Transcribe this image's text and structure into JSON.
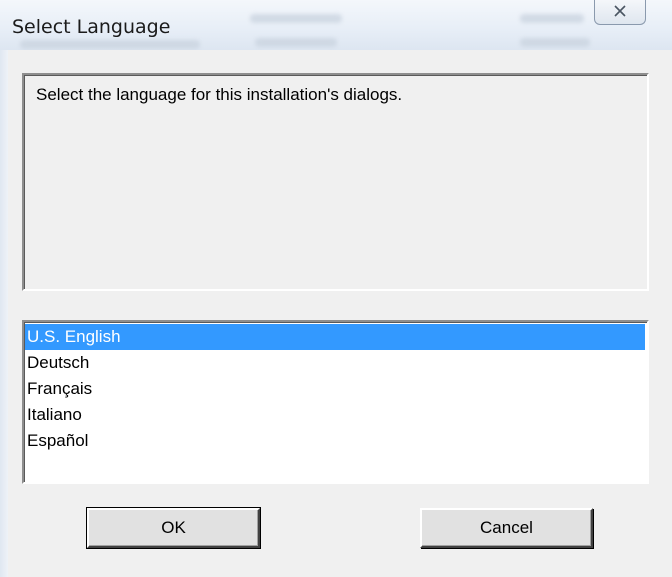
{
  "window": {
    "title": "Select Language",
    "close_icon": "close-icon"
  },
  "info": {
    "message": "Select the language for this installation's dialogs."
  },
  "languages": {
    "items": [
      "U.S. English",
      "Deutsch",
      "Français",
      "Italiano",
      "Español"
    ],
    "selected": "U.S. English"
  },
  "buttons": {
    "ok_label": "OK",
    "cancel_label": "Cancel"
  },
  "colors": {
    "selection": "#3399ff",
    "dialog_background": "#f0f0f0"
  }
}
